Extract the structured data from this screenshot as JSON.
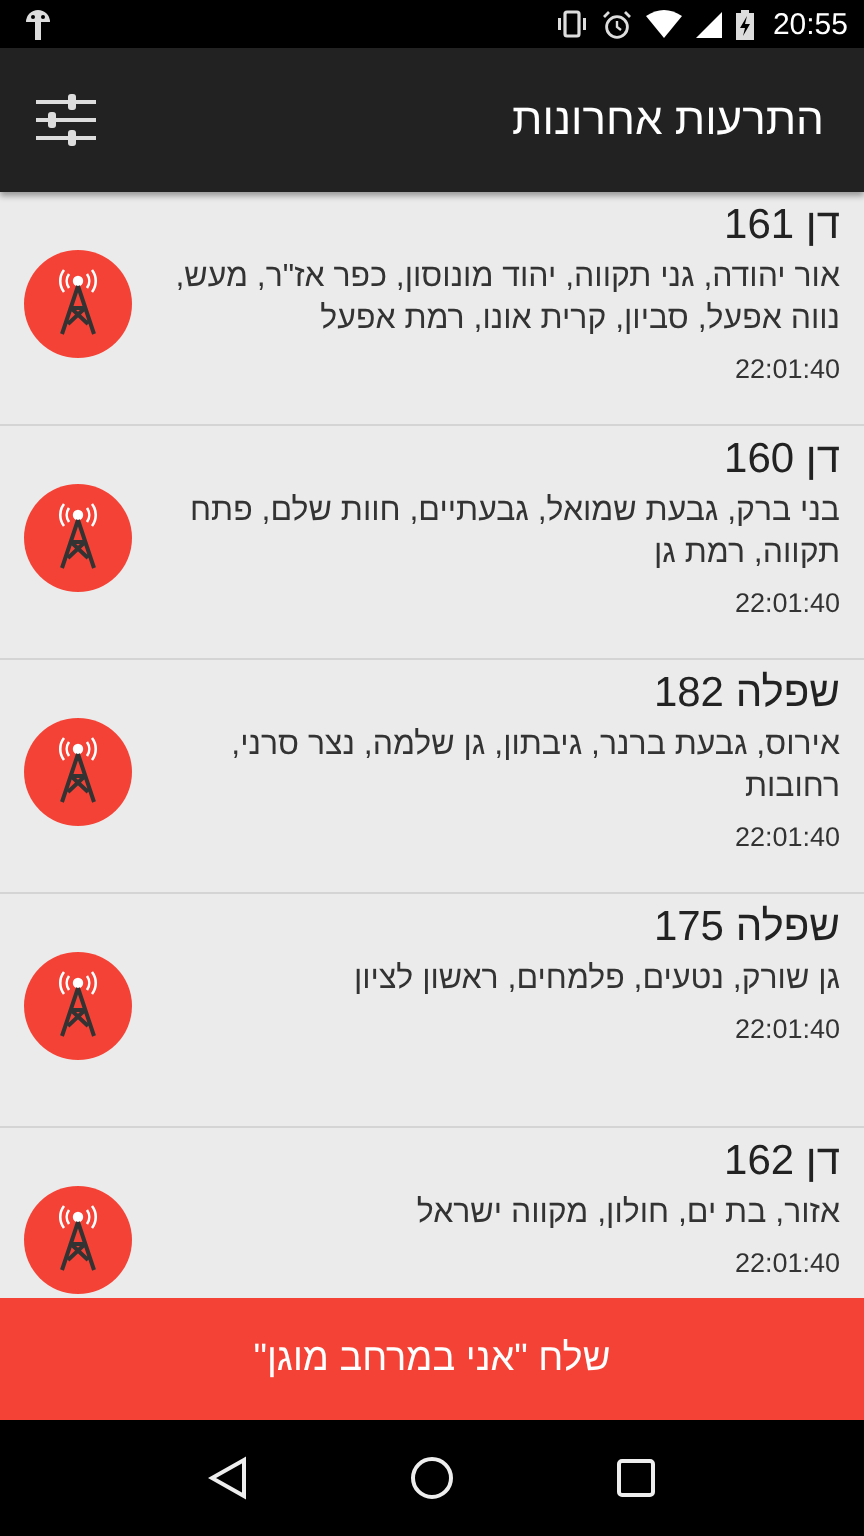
{
  "status_bar": {
    "time": "20:55"
  },
  "app_bar": {
    "title": "התרעות אחרונות"
  },
  "alerts": [
    {
      "title": "דן 161",
      "areas": "אור יהודה, גני תקווה, יהוד מונוסון, כפר אז\"ר, מעש, נווה אפעל, סביון, קרית אונו, רמת אפעל",
      "time": "22:01:40"
    },
    {
      "title": "דן 160",
      "areas": "בני ברק, גבעת שמואל, גבעתיים, חוות שלם, פתח תקווה, רמת גן",
      "time": "22:01:40"
    },
    {
      "title": "שפלה 182",
      "areas": "אירוס, גבעת ברנר, גיבתון, גן שלמה, נצר סרני, רחובות",
      "time": "22:01:40"
    },
    {
      "title": "שפלה 175",
      "areas": "גן שורק, נטעים, פלמחים, ראשון לציון",
      "time": "22:01:40"
    },
    {
      "title": "דן 162",
      "areas": "אזור, בת ים, חולון, מקווה ישראל",
      "time": "22:01:40"
    }
  ],
  "action_button": {
    "label": "שלח \"אני במרחב מוגן\""
  }
}
